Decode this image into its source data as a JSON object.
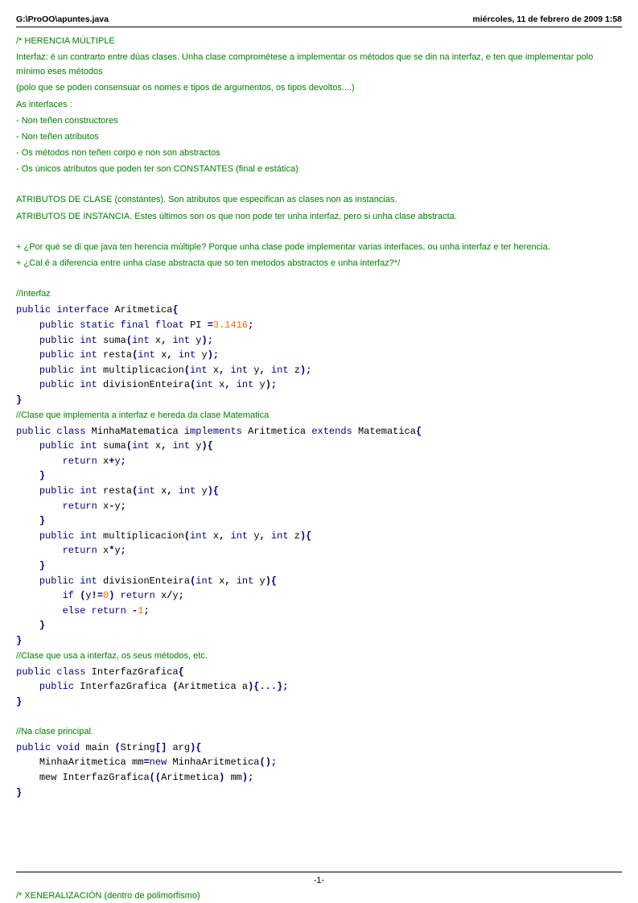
{
  "header": {
    "path": "G:\\ProOO\\apuntes.java",
    "datetime": "miércoles, 11 de febrero de 2009 1:58"
  },
  "footer": {
    "page": "-1-"
  },
  "comments": {
    "c1": "/* HERENCIA MÚLTIPLE",
    "c2": "Interfaz: é un contrarto entre dúas clases. Unha clase comprométese a implementar os métodos que se din na interfaz, e ten que implementar polo mínimo eses métodos",
    "c3": "(polo que se poden consensuar os nomes e tipos de argumentos, os tipos devoltos....)",
    "c4": "As interfaces :",
    "c5": "- Non teñen constructores",
    "c6": "- Non teñen atributos",
    "c7": "- Os métodos non teñen corpo e non son abstractos",
    "c8": "- Os únicos atributos que poden ter son CONSTANTES (final e estática)",
    "c9": "ATRIBUTOS DE CLASE (constantes). Son atributos que especifican as clases non as instancias.",
    "c10": "ATRIBUTOS DE INSTANCIA. Estes últimos son os que non pode ter unha interfaz, pero si unha clase abstracta.",
    "c11": "+ ¿Por qué se di que java ten herencia múltiple? Porque unha clase pode implementar varias interfaces, ou unha interfaz e ter herencia.",
    "c12": "+ ¿Cal é a diferencia entre  unha clase abstracta que so ten metodos abstractos e unha interfaz?*/",
    "c13": "//Interfaz",
    "c14": "//Clase que implementa a interfaz e hereda da clase Matematica",
    "c15": "//Clase que usa a interfaz, os seus métodos, etc.",
    "c16": "//Na clase principal.",
    "c17": "/* XENERALIZACIÓN (dentro de polimorfismo)"
  },
  "kw": {
    "public": "public",
    "interface": "interface",
    "static": "static",
    "final": "final",
    "float": "float",
    "int": "int",
    "class": "class",
    "implements": "implements",
    "extends": "extends",
    "return": "return",
    "if": "if",
    "else": "else",
    "void": "void",
    "new": "new"
  },
  "id": {
    "Aritmetica": "Aritmetica",
    "PI": "PI",
    "suma": "suma",
    "resta": "resta",
    "multiplicacion": "multiplicacion",
    "divisionEnteira": "divisionEnteira",
    "MinhaMatematica": "MinhaMatematica",
    "Matematica": "Matematica",
    "InterfazGrafica": "InterfazGrafica",
    "main": "main",
    "String": "String",
    "arg": "arg",
    "MinhaAritmetica": "MinhaAritmetica",
    "mm": "mm",
    "mew": "mew",
    "x": "x",
    "y": "y",
    "z": "z",
    "a": "a"
  },
  "lit": {
    "pi": "3.1416",
    "zero": "0",
    "one": "1",
    "negone": "1"
  },
  "p": {
    "ob": "{",
    "cb": "}",
    "op": "(",
    "cp": ")",
    "obk": "[]",
    "sc": ";",
    "cm": ",",
    "eq": "=",
    "plus": "+",
    "minus": "-",
    "star": "*",
    "div": "/",
    "ne": "!=",
    "dots": "{...};"
  }
}
